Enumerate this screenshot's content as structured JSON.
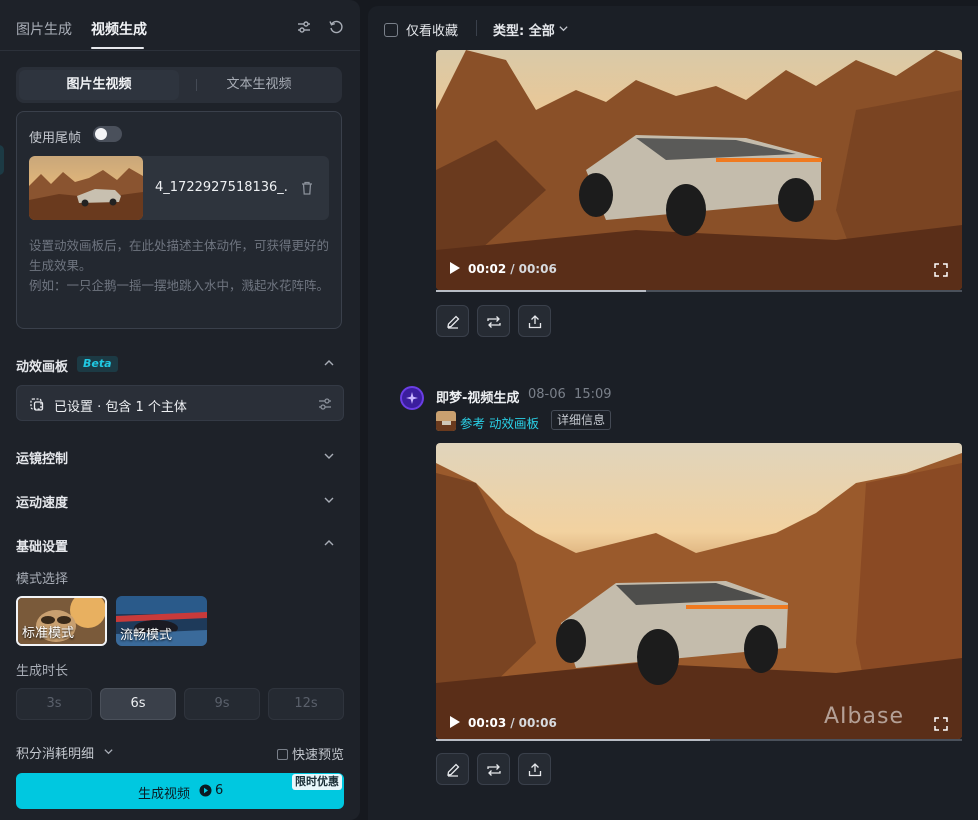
{
  "header": {
    "tab_image": "图片生成",
    "tab_video": "视频生成"
  },
  "segment": {
    "image_to_video": "图片生视频",
    "text_to_video": "文本生视频"
  },
  "upload": {
    "tail_frame_label": "使用尾帧",
    "file_name": "4_1722927518136_...",
    "description": "设置动效画板后，在此处描述主体动作，可获得更好的生成效果。\n例如：一只企鹅一摇一摆地跳入水中，溅起水花阵阵。"
  },
  "motion_board": {
    "title": "动效画板",
    "badge": "Beta",
    "status": "已设置 · 包含 1 个主体"
  },
  "sections": {
    "camera": "运镜控制",
    "speed": "运动速度",
    "basic": "基础设置"
  },
  "mode": {
    "label": "模式选择",
    "standard": "标准模式",
    "smooth": "流畅模式"
  },
  "duration": {
    "label": "生成时长",
    "options": [
      "3s",
      "6s",
      "9s",
      "12s"
    ],
    "selected": "6s"
  },
  "footer": {
    "credits": "积分消耗明细",
    "quick_preview": "快速预览",
    "generate": "生成视频",
    "cost": "6",
    "promo": "限时优惠"
  },
  "filters": {
    "favorites_only": "仅看收藏",
    "type": "类型: 全部"
  },
  "videos": [
    {
      "current": "00:02",
      "total": "00:06",
      "progress": 0.4
    },
    {
      "current": "00:03",
      "total": "00:06",
      "progress": 0.52
    }
  ],
  "generation": {
    "name": "即梦-视频生成",
    "date": "08-06",
    "time": "15:09",
    "reference": "参考 动效画板",
    "details": "详细信息"
  },
  "watermark": "AIbase",
  "colors": {
    "accent": "#00c8e0",
    "panel": "#1e2229",
    "background": "#16191f"
  }
}
